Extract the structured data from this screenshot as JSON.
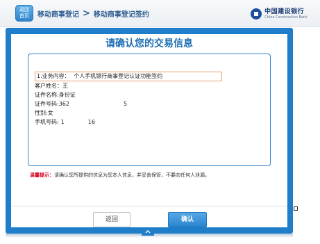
{
  "header": {
    "home_label_line1": "返回",
    "home_label_line2": "首页",
    "breadcrumb": [
      "移动商事登记",
      "移动商事登记签约"
    ],
    "bank_name_cn": "中国建设银行",
    "bank_name_en": "China Construction Bank"
  },
  "page": {
    "title": "请确认您的交易信息"
  },
  "transaction": {
    "business_label": "1.业务内容：",
    "business_value": "个人手机银行商事登记认证功能签约",
    "customer_name_label": "客户姓名：",
    "customer_name_value": "王",
    "id_type_label": "证件名称:",
    "id_type_value": "身份证",
    "id_number_label": "证件号码:",
    "id_number_prefix": "362",
    "id_number_suffix": "5",
    "gender_label": "性别:",
    "gender_value": "女",
    "phone_label": "手机号码:",
    "phone_prefix": "1",
    "phone_suffix": "16"
  },
  "tip": {
    "label": "温馨提示：",
    "text": "请确认您所提供的信息为您本人信息，并妥善保管，不要向任何人泄漏。"
  },
  "buttons": {
    "back": "返回",
    "confirm": "确认"
  },
  "colors": {
    "frame_blue": "#1e7ec9",
    "title_blue": "#1e6eb4",
    "tip_red": "#d0021b"
  }
}
